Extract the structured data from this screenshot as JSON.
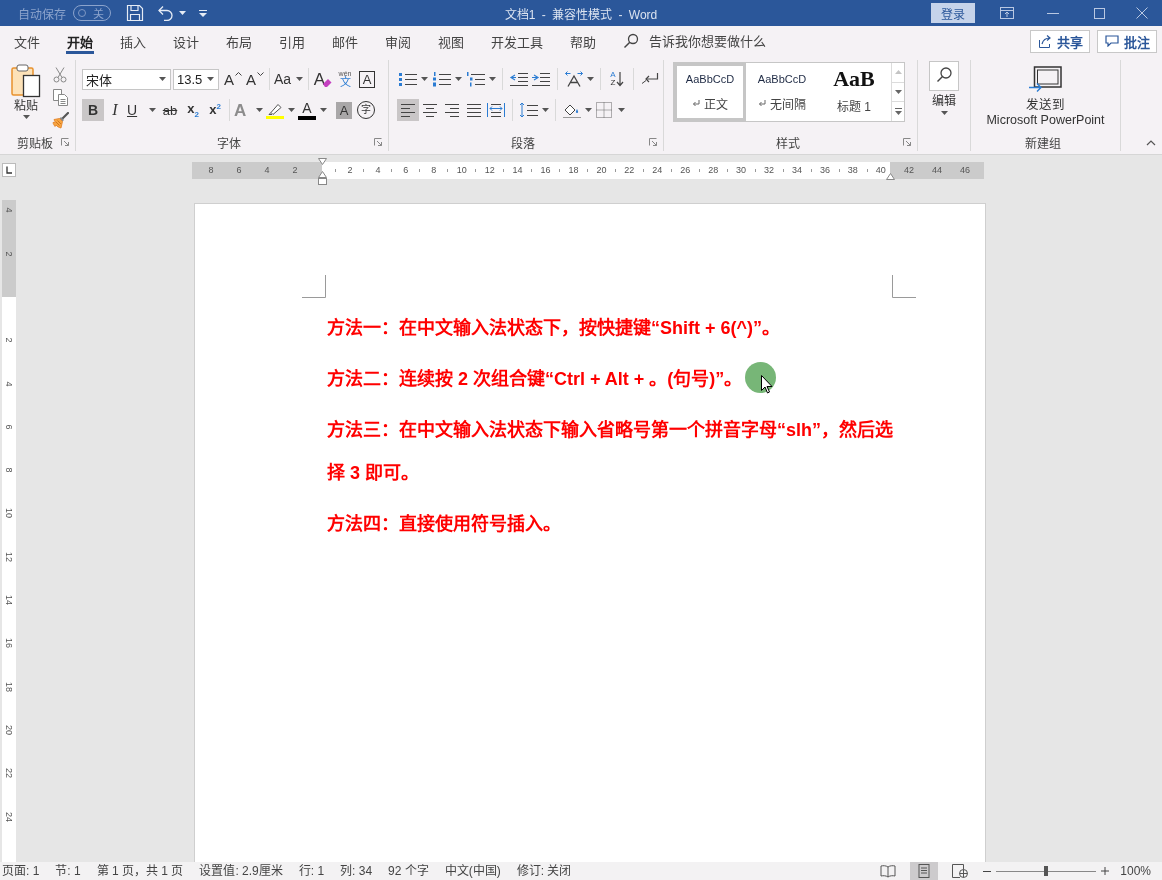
{
  "title_bar": {
    "autosave": {
      "label": "自动保存",
      "state_text": "关",
      "on": false,
      "disabled": true
    },
    "title": "文档1 - 兼容性模式 - Word",
    "sign_in": "登录"
  },
  "tabs": [
    {
      "label": "文件",
      "selected": false
    },
    {
      "label": "开始",
      "selected": true
    },
    {
      "label": "插入",
      "selected": false
    },
    {
      "label": "设计",
      "selected": false
    },
    {
      "label": "布局",
      "selected": false
    },
    {
      "label": "引用",
      "selected": false
    },
    {
      "label": "邮件",
      "selected": false
    },
    {
      "label": "审阅",
      "selected": false
    },
    {
      "label": "视图",
      "selected": false
    },
    {
      "label": "开发工具",
      "selected": false
    },
    {
      "label": "帮助",
      "selected": false
    }
  ],
  "tell_me": {
    "placeholder": "告诉我你想要做什么"
  },
  "share_button": {
    "label": "共享"
  },
  "comments_button": {
    "label": "批注"
  },
  "ribbon": {
    "clipboard": {
      "paste_label": "粘贴",
      "group_label": "剪贴板"
    },
    "font": {
      "font_name": "宋体",
      "font_size": "13.5",
      "group_label": "字体",
      "row_1": [
        [
          {
            "kind": "grow",
            "glyph": "A",
            "dropdown": false
          },
          {
            "kind": "shrink",
            "glyph": "A",
            "dropdown": false
          }
        ],
        [
          {
            "kind": "case",
            "glyph": "Aa",
            "dropdown": true
          }
        ],
        [
          {
            "kind": "clear",
            "glyph": "A",
            "dropdown": false
          },
          {
            "kind": "phonetic",
            "glyph": "wén",
            "glyph_2": "文",
            "dropdown": false
          },
          {
            "kind": "border",
            "glyph": "A",
            "dropdown": false
          }
        ]
      ],
      "row_2": [
        [
          {
            "kind": "bold",
            "glyph": "B",
            "selected": true,
            "dropdown": false
          },
          {
            "kind": "italic",
            "glyph": "I",
            "selected": false,
            "dropdown": false
          },
          {
            "kind": "underline",
            "glyph": "U",
            "selected": false,
            "dropdown": true
          },
          {
            "kind": "strike",
            "glyph": "ab",
            "selected": false,
            "dropdown": false
          },
          {
            "kind": "subscript",
            "glyph": "x$_{2}$",
            "selected": false,
            "dropdown": false
          },
          {
            "kind": "superscript",
            "glyph": "x$^{2}$",
            "selected": false,
            "dropdown": false
          }
        ],
        [
          {
            "kind": "effects",
            "glyph": "A",
            "disabled": true,
            "dropdown": true
          },
          {
            "kind": "highlight",
            "color": "#ffff00",
            "disabled": false,
            "dropdown": true
          },
          {
            "kind": "fontcolor",
            "glyph": "A",
            "color": "#000000",
            "disabled": false,
            "dropdown": true
          },
          {
            "kind": "shading",
            "glyph": "A",
            "disabled": false,
            "dropdown": false
          },
          {
            "kind": "enclosed",
            "glyph": "字",
            "disabled": false,
            "dropdown": false
          }
        ]
      ]
    },
    "paragraph": {
      "group_label": "段落",
      "row_1": [
        [
          {
            "kind": "bullets",
            "dropdown": true
          },
          {
            "kind": "numbering",
            "dropdown": true
          },
          {
            "kind": "multilevel",
            "dropdown": true
          }
        ],
        [
          {
            "kind": "decindent",
            "dropdown": false
          },
          {
            "kind": "incindent",
            "dropdown": false
          }
        ],
        [
          {
            "kind": "asian",
            "dropdown": true
          }
        ],
        [
          {
            "kind": "sort",
            "glyph": "A",
            "glyph_2": "Z",
            "dropdown": false
          }
        ],
        [
          {
            "kind": "showhide",
            "dropdown": false
          }
        ]
      ],
      "row_2": [
        [
          {
            "kind": "left",
            "selected": true,
            "dropdown": false
          },
          {
            "kind": "center",
            "selected": false,
            "dropdown": false
          },
          {
            "kind": "right",
            "selected": false,
            "dropdown": false
          },
          {
            "kind": "justify",
            "selected": false,
            "dropdown": false
          },
          {
            "kind": "distributed",
            "selected": false,
            "dropdown": false
          }
        ],
        [
          {
            "kind": "linespacing",
            "dropdown": true
          }
        ],
        [
          {
            "kind": "parashading",
            "dropdown": true
          },
          {
            "kind": "borders",
            "dropdown": true
          }
        ]
      ]
    },
    "styles": {
      "group_label": "样式",
      "items": [
        {
          "kind": "body",
          "preview": "AaBbCcD",
          "name": "正文",
          "paragraph_mark": true,
          "selected": true
        },
        {
          "kind": "body",
          "preview": "AaBbCcD",
          "name": "无间隔",
          "paragraph_mark": true,
          "selected": false
        },
        {
          "kind": "heading",
          "preview": "AaB",
          "name": "标题 1",
          "paragraph_mark": false,
          "selected": false
        }
      ]
    },
    "editing": {
      "button_label": "编辑"
    },
    "new_group": {
      "label_lines": [
        "发送到",
        "Microsoft PowerPoint"
      ],
      "group_label": "新建组"
    }
  },
  "ruler": {
    "left_numbers": [
      "8",
      "6",
      "4",
      "2"
    ],
    "numbers": [
      "2",
      "4",
      "6",
      "8",
      "10",
      "12",
      "14",
      "16",
      "18",
      "20",
      "22",
      "24",
      "26",
      "28",
      "30",
      "32",
      "34",
      "36",
      "38",
      "40"
    ],
    "right_numbers": [
      "42",
      "44",
      "46"
    ]
  },
  "vertical_ruler": {
    "top_numbers": [
      "4",
      "2"
    ],
    "numbers": [
      "2",
      "4",
      "6",
      "8",
      "10",
      "12",
      "14",
      "16",
      "18",
      "20",
      "22",
      "24"
    ]
  },
  "document": {
    "paragraphs": [
      "方法一：在中文输入法状态下，按快捷键“Shift + 6(^)”。",
      "方法二：连续按 2 次组合键“Ctrl + Alt + 。(句号)”。",
      "方法三：在中文输入法状态下输入省略号第一个拼音字母“slh”，然后选择 3 即可。",
      "方法四：直接使用符号插入。"
    ]
  },
  "status_bar": {
    "items": [
      "页面: 1",
      "节: 1",
      "第 1 页，共 1 页",
      "设置值: 2.9厘米",
      "行: 1",
      "列: 34",
      "92 个字",
      "中文(中国)",
      "修订: 关闭"
    ],
    "views": [
      {
        "kind": "read",
        "selected": false
      },
      {
        "kind": "print",
        "selected": true
      },
      {
        "kind": "web",
        "selected": false
      }
    ],
    "zoom": {
      "level": 0.5,
      "reading": "100%"
    }
  }
}
